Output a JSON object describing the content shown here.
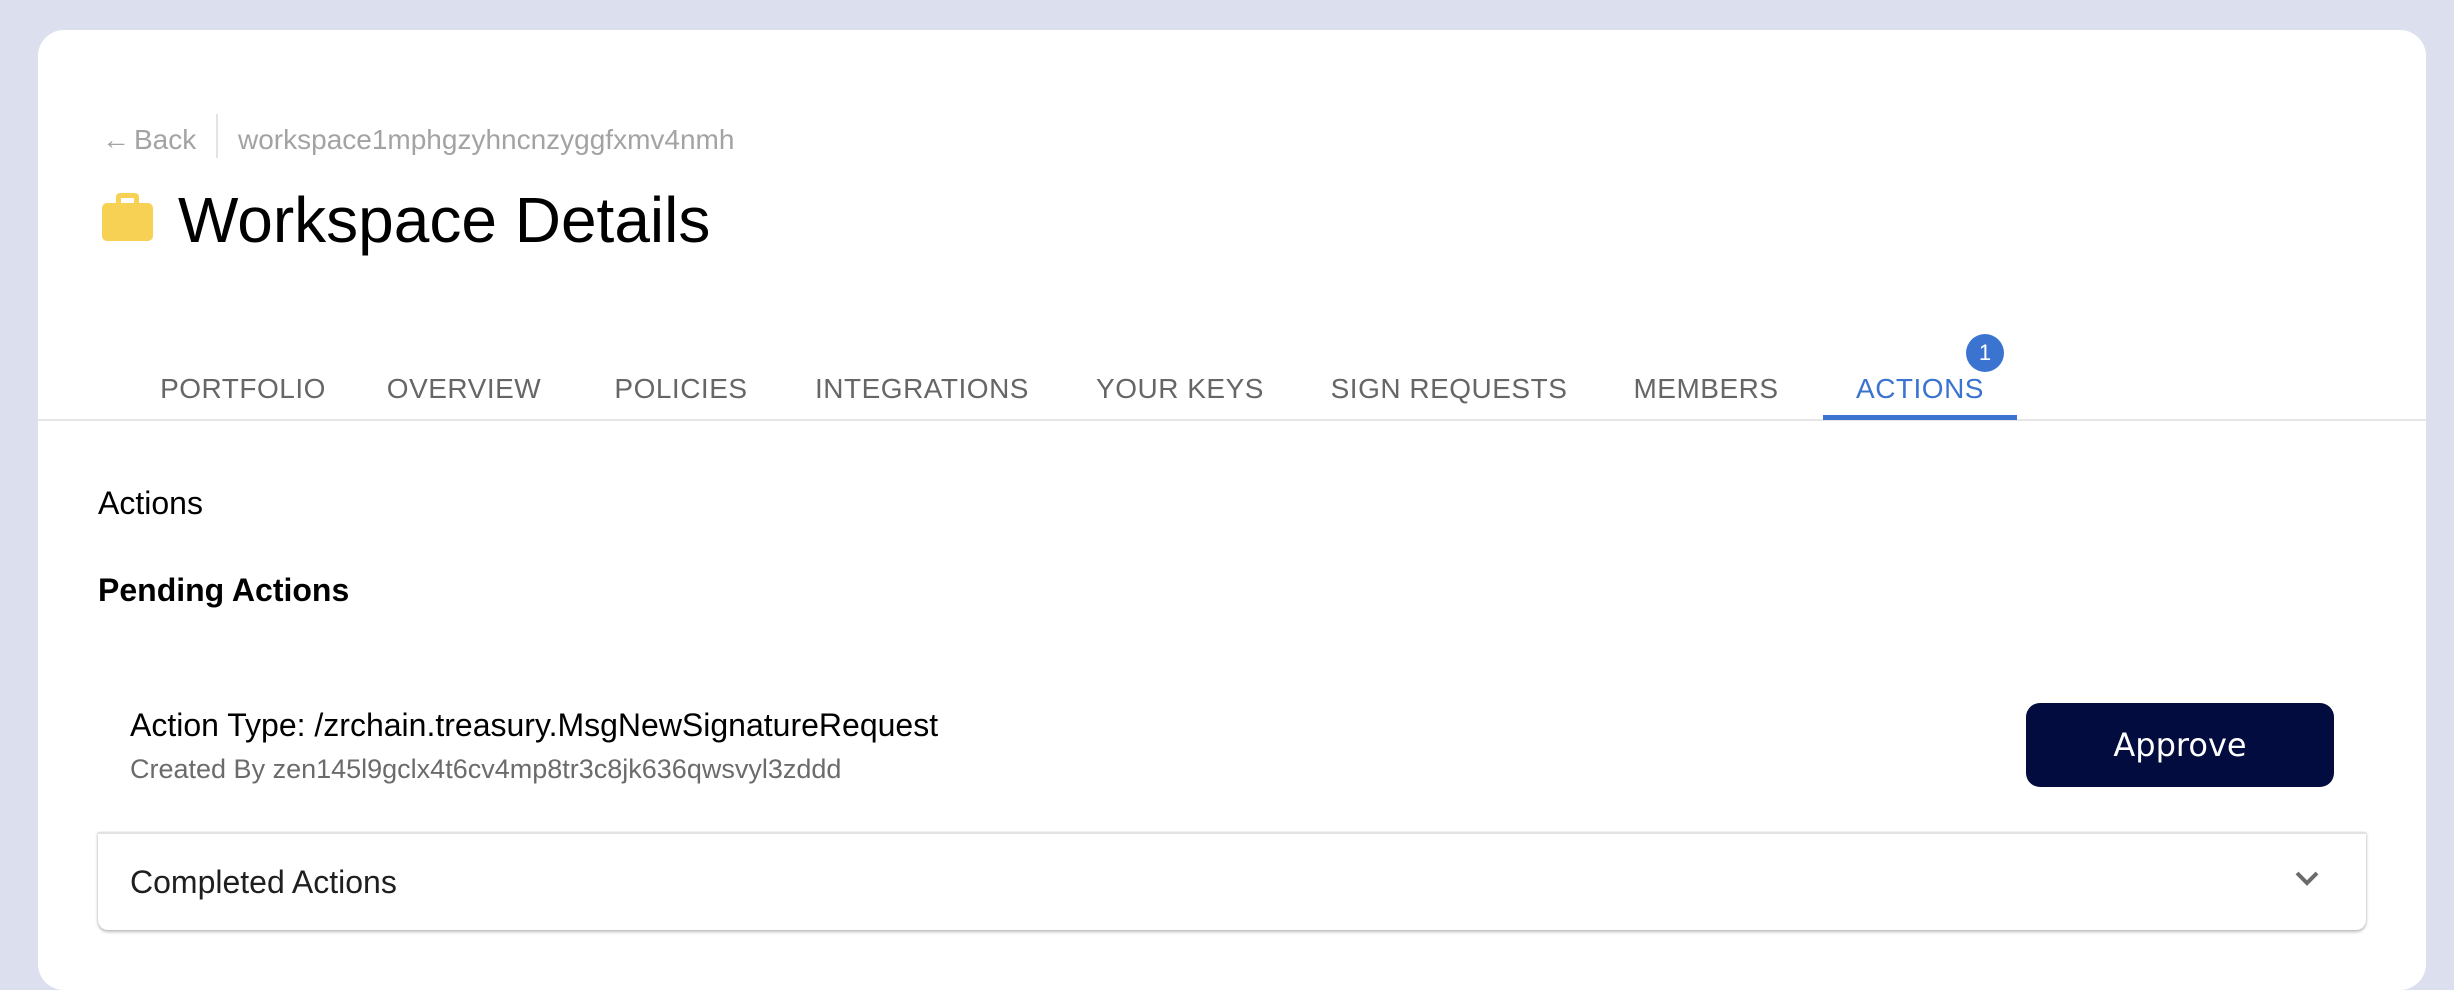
{
  "breadcrumb": {
    "back_label": "Back",
    "back_icon": "arrow-left-icon",
    "current": "workspace1mphgzyhncnzyggfxmv4nmh"
  },
  "header": {
    "icon": "briefcase-icon",
    "icon_color": "#f7d154",
    "title": "Workspace Details"
  },
  "tabs": [
    {
      "label": "PORTFOLIO"
    },
    {
      "label": "OVERVIEW"
    },
    {
      "label": "POLICIES"
    },
    {
      "label": "INTEGRATIONS"
    },
    {
      "label": "YOUR KEYS"
    },
    {
      "label": "SIGN REQUESTS"
    },
    {
      "label": "MEMBERS"
    },
    {
      "label": "ACTIONS",
      "active": true,
      "badge": "1"
    }
  ],
  "accent_color": "#3a74d0",
  "content": {
    "section_title": "Actions",
    "pending_title": "Pending Actions",
    "pending_actions": [
      {
        "action_type": "Action Type: /zrchain.treasury.MsgNewSignatureRequest",
        "created_by": "Created By zen145l9gclx4t6cv4mp8tr3c8jk636qwsvyl3zddd",
        "button_label": "Approve"
      }
    ],
    "completed_label": "Completed Actions",
    "completed_expanded": false
  }
}
